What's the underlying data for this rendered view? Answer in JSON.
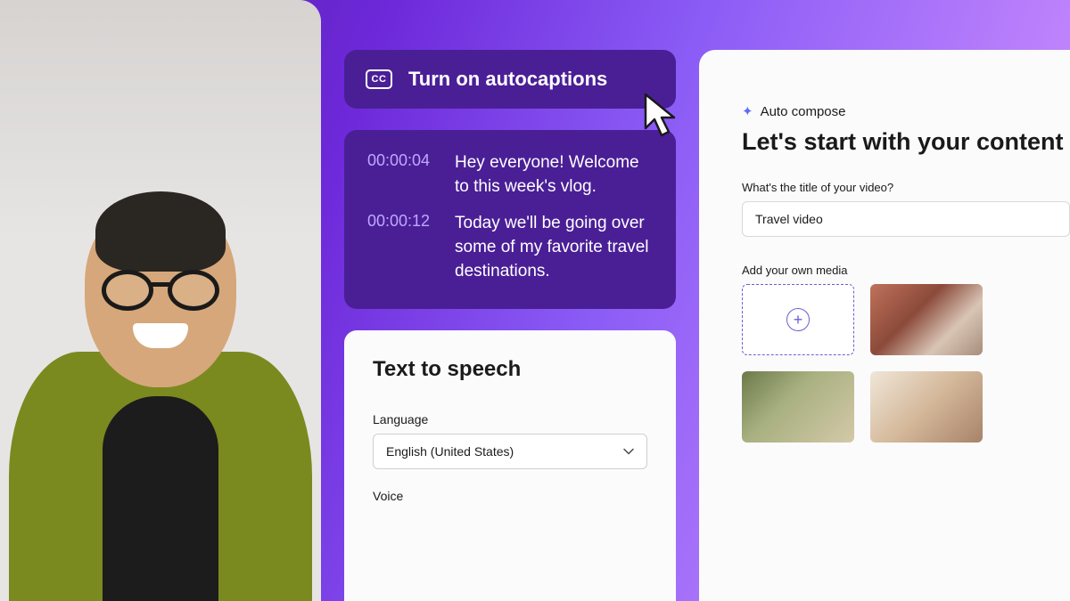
{
  "autocaptions": {
    "button_label": "Turn on autocaptions",
    "cc_glyph": "CC"
  },
  "captions": [
    {
      "time": "00:00:04",
      "text": "Hey everyone! Welcome to this week's vlog."
    },
    {
      "time": "00:00:12",
      "text": "Today we'll be going over some of my favorite travel destinations."
    }
  ],
  "tts": {
    "title": "Text to speech",
    "language_label": "Language",
    "language_value": "English (United States)",
    "voice_label": "Voice"
  },
  "compose": {
    "badge": "Auto compose",
    "heading": "Let's start with your content",
    "title_label": "What's the title of your video?",
    "title_value": "Travel video",
    "media_label": "Add your own media"
  }
}
